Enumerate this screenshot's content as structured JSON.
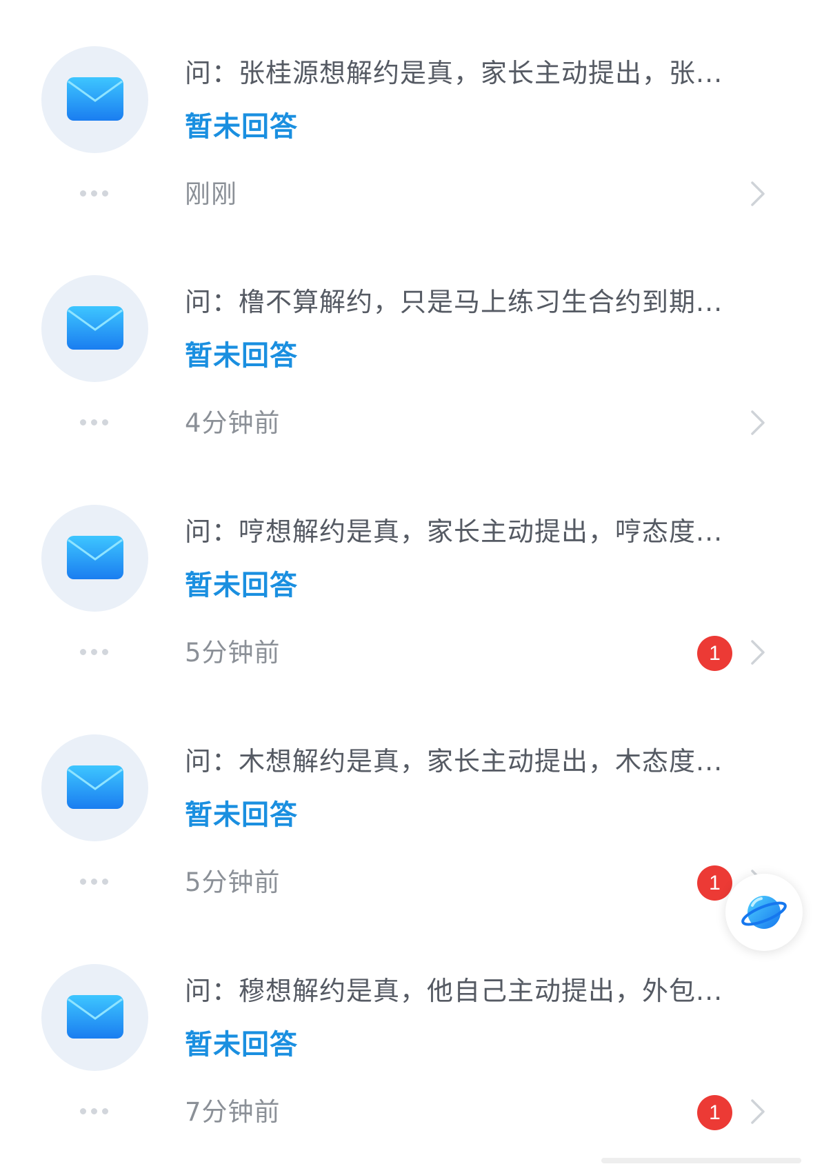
{
  "messages": [
    {
      "question": "问：张桂源想解约是真，家长主动提出，张...",
      "status": "暂未回答",
      "time": "刚刚",
      "badge": null
    },
    {
      "question": "问：橹不算解约，只是马上练习生合约到期...",
      "status": "暂未回答",
      "time": "4分钟前",
      "badge": null
    },
    {
      "question": "问：哼想解约是真，家长主动提出，哼态度...",
      "status": "暂未回答",
      "time": "5分钟前",
      "badge": "1"
    },
    {
      "question": "问：木想解约是真，家长主动提出，木态度...",
      "status": "暂未回答",
      "time": "5分钟前",
      "badge": "1"
    },
    {
      "question": "问：穆想解约是真，他自己主动提出，外包...",
      "status": "暂未回答",
      "time": "7分钟前",
      "badge": "1"
    }
  ],
  "icons": {
    "avatar": "mail-icon",
    "more": "more-icon",
    "arrow": "chevron-right-icon",
    "floating": "planet-icon"
  },
  "colors": {
    "accent": "#1a8fe0",
    "badge": "#ec3a35",
    "avatar_bg": "#eaf0f8"
  }
}
